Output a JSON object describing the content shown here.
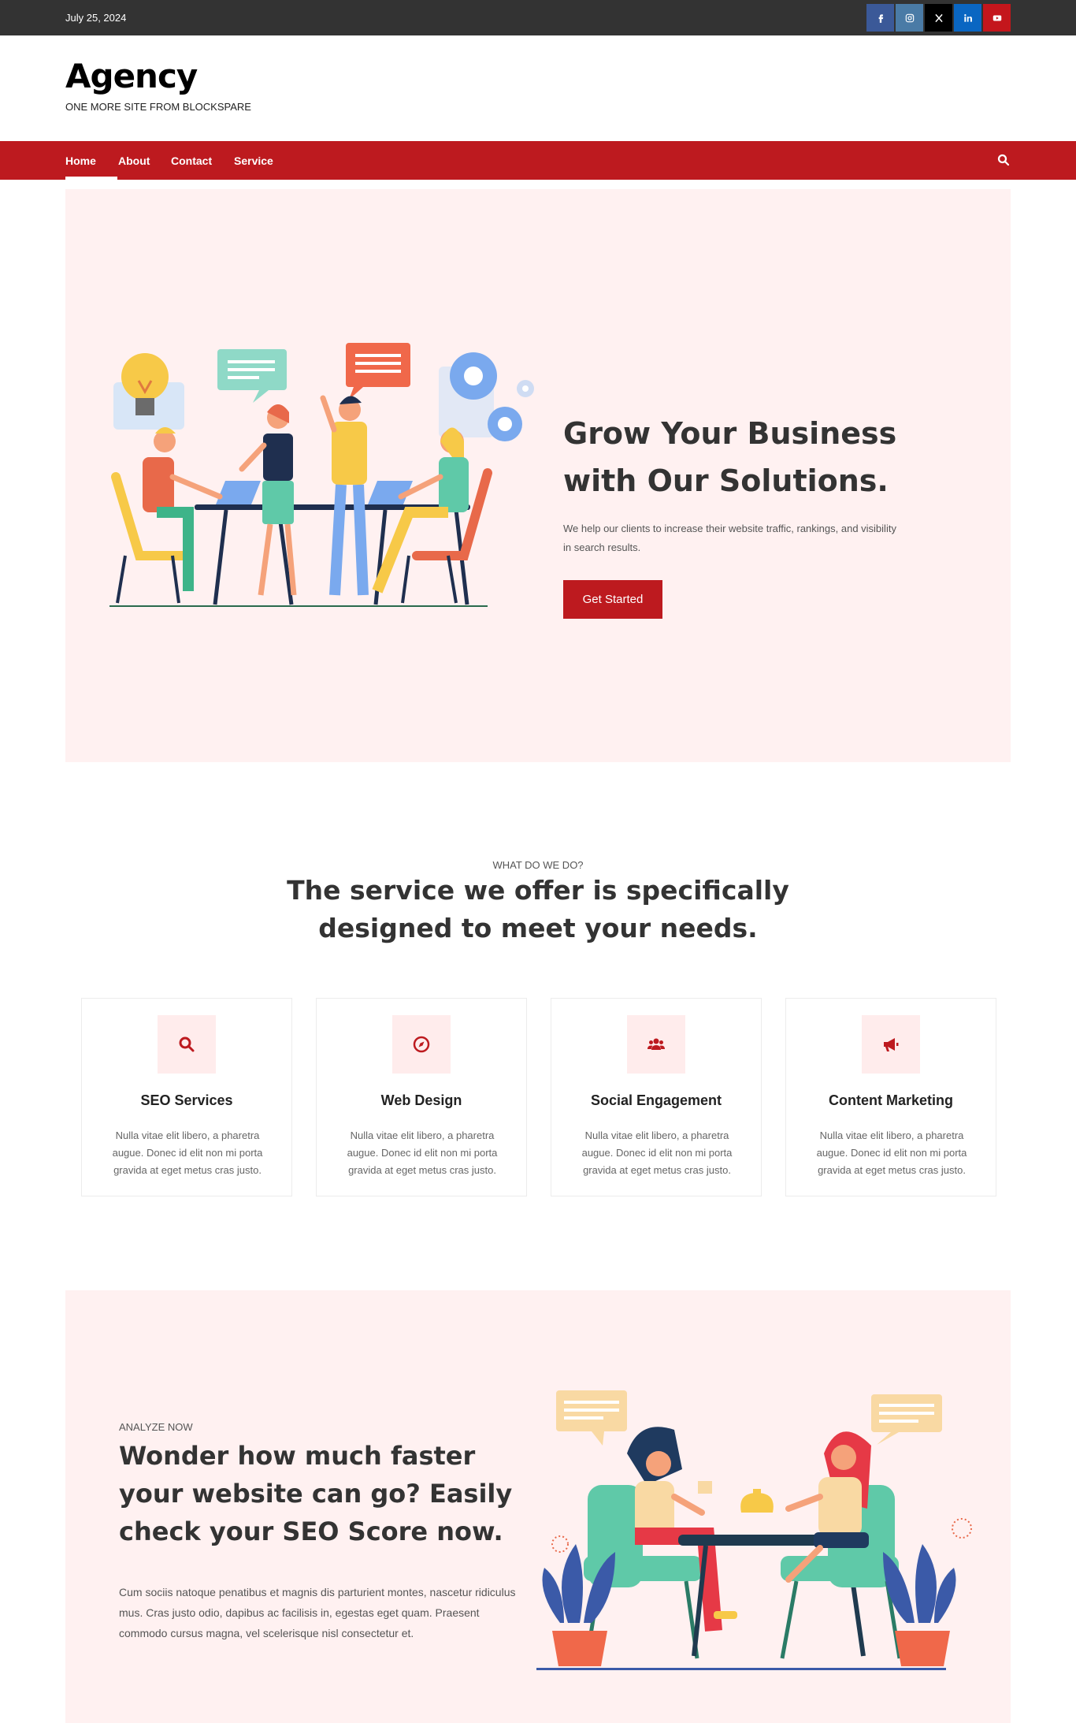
{
  "topbar": {
    "date": "July 25, 2024",
    "social": [
      {
        "icon": "facebook-icon",
        "color": "#3b5998"
      },
      {
        "icon": "instagram-icon",
        "color": "#4a7ba6"
      },
      {
        "icon": "x-icon",
        "color": "#000000"
      },
      {
        "icon": "linkedin-icon",
        "color": "#0a66c2"
      },
      {
        "icon": "youtube-icon",
        "color": "#c4161c"
      }
    ]
  },
  "header": {
    "site_title": "Agency",
    "tagline": "ONE MORE SITE FROM BLOCKSPARE"
  },
  "nav": {
    "items": [
      "Home",
      "About",
      "Contact",
      "Service"
    ],
    "active": "Home",
    "search_icon": "search-icon",
    "color": "#bd1a1f"
  },
  "hero": {
    "title_line1": "Grow Your Business",
    "title_line2": "with Our Solutions.",
    "text": "We help our clients to increase their website traffic, rankings, and visibility in search results.",
    "button": "Get Started"
  },
  "services": {
    "kicker": "WHAT DO WE DO?",
    "title": "The service we offer is specifically designed to meet your needs.",
    "cards": [
      {
        "name": "SEO Services",
        "icon": "search-icon",
        "desc": "Nulla vitae elit libero, a pharetra augue. Donec id elit non mi porta gravida at eget metus cras justo."
      },
      {
        "name": "Web Design",
        "icon": "compass-icon",
        "desc": "Nulla vitae elit libero, a pharetra augue. Donec id elit non mi porta gravida at eget metus cras justo."
      },
      {
        "name": "Social Engagement",
        "icon": "users-icon",
        "desc": "Nulla vitae elit libero, a pharetra augue. Donec id elit non mi porta gravida at eget metus cras justo."
      },
      {
        "name": "Content Marketing",
        "icon": "megaphone-icon",
        "desc": "Nulla vitae elit libero, a pharetra augue. Donec id elit non mi porta gravida at eget metus cras justo."
      }
    ]
  },
  "analyze": {
    "kicker": "ANALYZE NOW",
    "title": "Wonder how much faster your website can go? Easily check your SEO Score now.",
    "text": "Cum sociis natoque penatibus et magnis dis parturient montes, nascetur ridiculus mus. Cras justo odio, dapibus ac facilisis in, egestas eget quam. Praesent commodo cursus magna, vel scelerisque nisl consectetur et."
  }
}
